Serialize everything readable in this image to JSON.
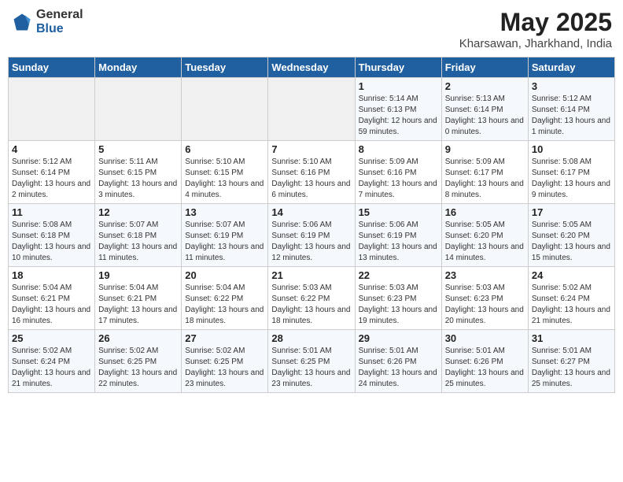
{
  "header": {
    "logo_general": "General",
    "logo_blue": "Blue",
    "title": "May 2025",
    "location": "Kharsawan, Jharkhand, India"
  },
  "days_of_week": [
    "Sunday",
    "Monday",
    "Tuesday",
    "Wednesday",
    "Thursday",
    "Friday",
    "Saturday"
  ],
  "weeks": [
    [
      {
        "day": "",
        "content": ""
      },
      {
        "day": "",
        "content": ""
      },
      {
        "day": "",
        "content": ""
      },
      {
        "day": "",
        "content": ""
      },
      {
        "day": "1",
        "content": "Sunrise: 5:14 AM\nSunset: 6:13 PM\nDaylight: 12 hours and 59 minutes."
      },
      {
        "day": "2",
        "content": "Sunrise: 5:13 AM\nSunset: 6:14 PM\nDaylight: 13 hours and 0 minutes."
      },
      {
        "day": "3",
        "content": "Sunrise: 5:12 AM\nSunset: 6:14 PM\nDaylight: 13 hours and 1 minute."
      }
    ],
    [
      {
        "day": "4",
        "content": "Sunrise: 5:12 AM\nSunset: 6:14 PM\nDaylight: 13 hours and 2 minutes."
      },
      {
        "day": "5",
        "content": "Sunrise: 5:11 AM\nSunset: 6:15 PM\nDaylight: 13 hours and 3 minutes."
      },
      {
        "day": "6",
        "content": "Sunrise: 5:10 AM\nSunset: 6:15 PM\nDaylight: 13 hours and 4 minutes."
      },
      {
        "day": "7",
        "content": "Sunrise: 5:10 AM\nSunset: 6:16 PM\nDaylight: 13 hours and 6 minutes."
      },
      {
        "day": "8",
        "content": "Sunrise: 5:09 AM\nSunset: 6:16 PM\nDaylight: 13 hours and 7 minutes."
      },
      {
        "day": "9",
        "content": "Sunrise: 5:09 AM\nSunset: 6:17 PM\nDaylight: 13 hours and 8 minutes."
      },
      {
        "day": "10",
        "content": "Sunrise: 5:08 AM\nSunset: 6:17 PM\nDaylight: 13 hours and 9 minutes."
      }
    ],
    [
      {
        "day": "11",
        "content": "Sunrise: 5:08 AM\nSunset: 6:18 PM\nDaylight: 13 hours and 10 minutes."
      },
      {
        "day": "12",
        "content": "Sunrise: 5:07 AM\nSunset: 6:18 PM\nDaylight: 13 hours and 11 minutes."
      },
      {
        "day": "13",
        "content": "Sunrise: 5:07 AM\nSunset: 6:19 PM\nDaylight: 13 hours and 11 minutes."
      },
      {
        "day": "14",
        "content": "Sunrise: 5:06 AM\nSunset: 6:19 PM\nDaylight: 13 hours and 12 minutes."
      },
      {
        "day": "15",
        "content": "Sunrise: 5:06 AM\nSunset: 6:19 PM\nDaylight: 13 hours and 13 minutes."
      },
      {
        "day": "16",
        "content": "Sunrise: 5:05 AM\nSunset: 6:20 PM\nDaylight: 13 hours and 14 minutes."
      },
      {
        "day": "17",
        "content": "Sunrise: 5:05 AM\nSunset: 6:20 PM\nDaylight: 13 hours and 15 minutes."
      }
    ],
    [
      {
        "day": "18",
        "content": "Sunrise: 5:04 AM\nSunset: 6:21 PM\nDaylight: 13 hours and 16 minutes."
      },
      {
        "day": "19",
        "content": "Sunrise: 5:04 AM\nSunset: 6:21 PM\nDaylight: 13 hours and 17 minutes."
      },
      {
        "day": "20",
        "content": "Sunrise: 5:04 AM\nSunset: 6:22 PM\nDaylight: 13 hours and 18 minutes."
      },
      {
        "day": "21",
        "content": "Sunrise: 5:03 AM\nSunset: 6:22 PM\nDaylight: 13 hours and 18 minutes."
      },
      {
        "day": "22",
        "content": "Sunrise: 5:03 AM\nSunset: 6:23 PM\nDaylight: 13 hours and 19 minutes."
      },
      {
        "day": "23",
        "content": "Sunrise: 5:03 AM\nSunset: 6:23 PM\nDaylight: 13 hours and 20 minutes."
      },
      {
        "day": "24",
        "content": "Sunrise: 5:02 AM\nSunset: 6:24 PM\nDaylight: 13 hours and 21 minutes."
      }
    ],
    [
      {
        "day": "25",
        "content": "Sunrise: 5:02 AM\nSunset: 6:24 PM\nDaylight: 13 hours and 21 minutes."
      },
      {
        "day": "26",
        "content": "Sunrise: 5:02 AM\nSunset: 6:25 PM\nDaylight: 13 hours and 22 minutes."
      },
      {
        "day": "27",
        "content": "Sunrise: 5:02 AM\nSunset: 6:25 PM\nDaylight: 13 hours and 23 minutes."
      },
      {
        "day": "28",
        "content": "Sunrise: 5:01 AM\nSunset: 6:25 PM\nDaylight: 13 hours and 23 minutes."
      },
      {
        "day": "29",
        "content": "Sunrise: 5:01 AM\nSunset: 6:26 PM\nDaylight: 13 hours and 24 minutes."
      },
      {
        "day": "30",
        "content": "Sunrise: 5:01 AM\nSunset: 6:26 PM\nDaylight: 13 hours and 25 minutes."
      },
      {
        "day": "31",
        "content": "Sunrise: 5:01 AM\nSunset: 6:27 PM\nDaylight: 13 hours and 25 minutes."
      }
    ]
  ]
}
